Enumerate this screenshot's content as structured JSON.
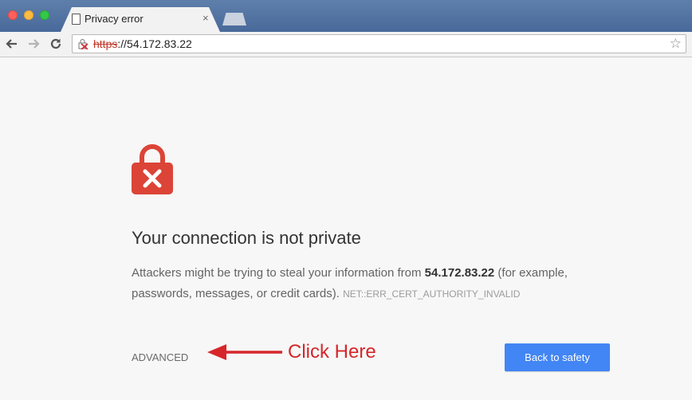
{
  "browser": {
    "tab": {
      "title": "Privacy error",
      "close_glyph": "×"
    },
    "address_bar": {
      "scheme": "https",
      "separator": "://",
      "host": "54.172.83.22",
      "star_glyph": "☆"
    }
  },
  "page": {
    "heading": "Your connection is not private",
    "explanation": {
      "before_host": "Attackers might be trying to steal your information from ",
      "host": "54.172.83.22",
      "after_host": " (for example, passwords, messages, or credit cards). ",
      "error_code": "NET::ERR_CERT_AUTHORITY_INVALID"
    },
    "advanced_label": "ADVANCED",
    "back_button_label": "Back to safety"
  },
  "annotation": {
    "text": "Click Here"
  },
  "colors": {
    "lock_red": "#db4437",
    "button_blue": "#4285f4",
    "annotation_red": "#d7262b",
    "scheme_red": "#c0392b"
  }
}
